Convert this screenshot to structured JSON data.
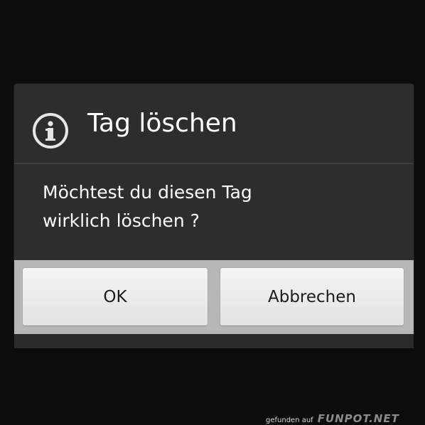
{
  "dialog": {
    "title": "Tag löschen",
    "icon": "info-icon",
    "message_line1": "Möchtest du diesen Tag",
    "message_line2": "wirklich löschen ?",
    "buttons": {
      "ok_label": "OK",
      "cancel_label": "Abbrechen"
    }
  },
  "watermark": {
    "prefix": "gefunden auf",
    "brand": "FUNPOT.NET"
  },
  "colors": {
    "dialog_background": "#2d2d2d",
    "button_bar": "#b7b7b7",
    "button": "#eeeeee",
    "text_light": "#ffffff",
    "text_dark": "#1b1b1b"
  }
}
